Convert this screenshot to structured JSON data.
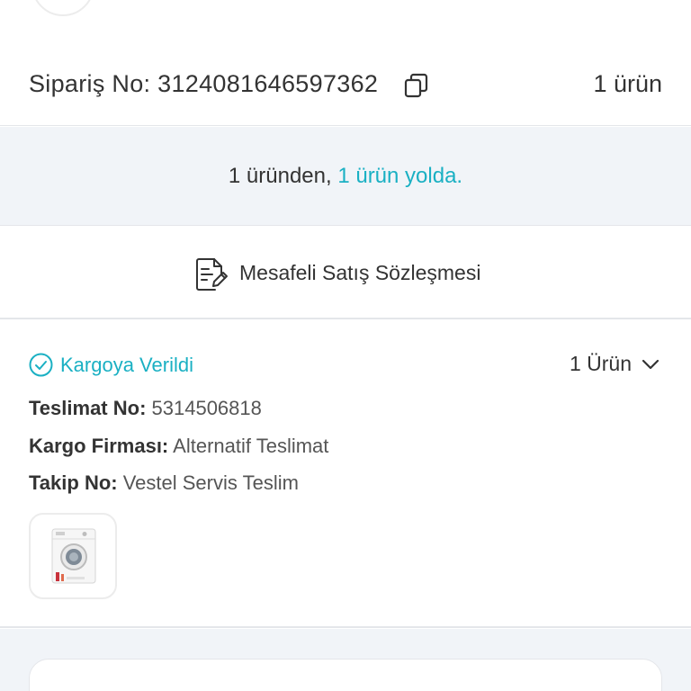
{
  "top": {
    "partial_text": ""
  },
  "order": {
    "label": "Sipariş No: 3124081646597362",
    "count": "1 ürün"
  },
  "status_band": {
    "prefix": "1 üründen, ",
    "highlight": "1 ürün yolda."
  },
  "contract": {
    "label": "Mesafeli Satış Sözleşmesi"
  },
  "shipment": {
    "status": "Kargoya Verildi",
    "dropdown": "1 Ürün",
    "delivery_label": "Teslimat No:",
    "delivery_value": "5314506818",
    "carrier_label": "Kargo Firması:",
    "carrier_value": "Alternatif Teslimat",
    "tracking_label": "Takip No:",
    "tracking_value": "Vestel Servis Teslim"
  },
  "colors": {
    "accent": "#1ab0c3",
    "band": "#f1f4f8",
    "text": "#333333"
  },
  "icons": {
    "copy": "copy-icon",
    "document": "document-edit-icon",
    "status": "check-circle-icon",
    "chevron": "chevron-down-icon",
    "product": "washing-machine-image"
  }
}
